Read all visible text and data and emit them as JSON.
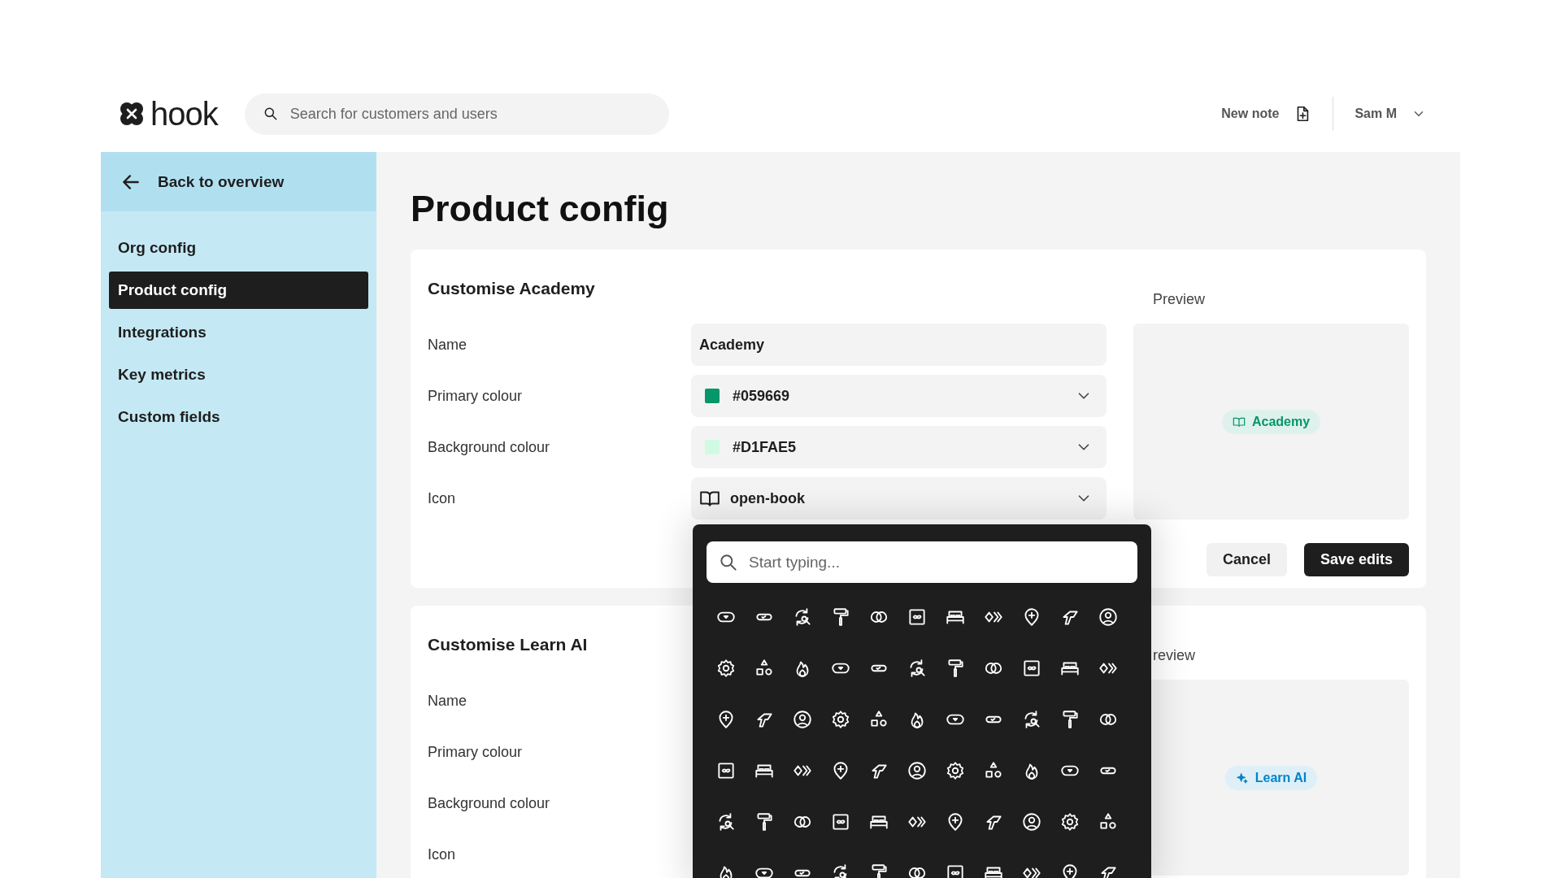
{
  "header": {
    "logo": "hook",
    "search": {
      "placeholder": "Search for customers and users"
    },
    "new_note": "New note",
    "user": "Sam M"
  },
  "sidebar": {
    "back": "Back to overview",
    "items": [
      {
        "label": "Org config",
        "selected": false
      },
      {
        "label": "Product config",
        "selected": true
      },
      {
        "label": "Integrations",
        "selected": false
      },
      {
        "label": "Key metrics",
        "selected": false
      },
      {
        "label": "Custom fields",
        "selected": false
      }
    ]
  },
  "page_title": "Product config",
  "cards": [
    {
      "title": "Customise Academy",
      "preview_label": "Preview",
      "fields": [
        {
          "kind": "text",
          "label": "Name",
          "value": "Academy"
        },
        {
          "kind": "colour",
          "label": "Primary colour",
          "value": "#059669",
          "color": "#059669"
        },
        {
          "kind": "colour",
          "label": "Background colour",
          "value": "#D1FAE5",
          "color": "#d1fae5"
        },
        {
          "kind": "icon",
          "label": "Icon",
          "value": "open-book",
          "expanded": true,
          "picker": {
            "placeholder": "Start typing..."
          }
        }
      ],
      "badge": {
        "kind": "book",
        "label": "Academy",
        "color": "#059669"
      },
      "actions": [
        {
          "kind": "secondary",
          "label": "Cancel"
        },
        {
          "kind": "primary",
          "label": "Save edits"
        }
      ]
    },
    {
      "title": "Customise Learn AI",
      "preview_label": "review",
      "fields": [
        {
          "label": "Name"
        },
        {
          "label": "Primary colour"
        },
        {
          "label": "Background colour"
        },
        {
          "label": "Icon"
        }
      ],
      "badge": {
        "kind": "sparkles",
        "label": "Learn AI",
        "color": "#0284c7"
      }
    }
  ]
}
